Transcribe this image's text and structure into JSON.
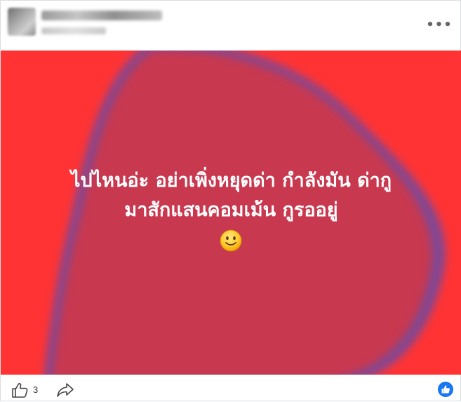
{
  "post": {
    "author_name": "",
    "lines": [
      "ไปไหนอ่ะ อย่าเพิ่งหยุดด่า กำลังมัน ด่ากู",
      "มาสักแสนคอมเม้น กูรออยู่"
    ],
    "emoji": "slightly-smiling-face",
    "background_color": "#ff3333",
    "blob_color": "#c8394f",
    "blob_edge_color": "#7a4a9a"
  },
  "footer": {
    "like_count": "3",
    "reaction_icon": "thumbs-up-reaction"
  },
  "header": {
    "more_icon": "more-options-icon",
    "more_label": "•••"
  }
}
